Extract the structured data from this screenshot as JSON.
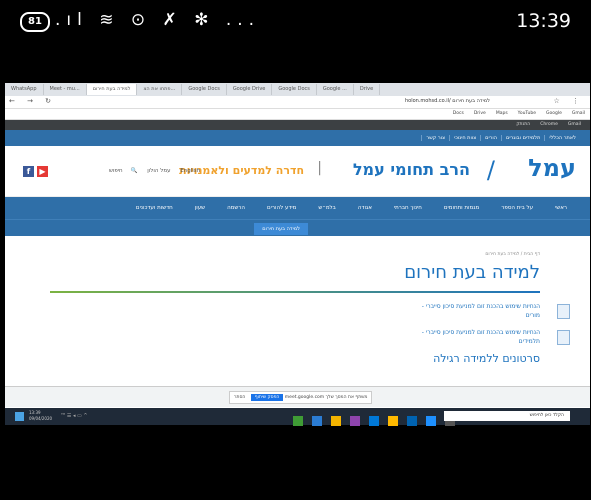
{
  "status_bar": {
    "battery": "81",
    "time": "13:39",
    "icons": ".ıl ≋ ⊙ ✗ ✻ ..."
  },
  "browser": {
    "tabs": [
      "WhatsApp",
      "Meet - mu...",
      "למידה בעת חירום",
      "פתחו את הצ...",
      "Google Docs",
      "Google Drive",
      "Google Docs",
      "Google ...",
      "Drive"
    ],
    "url": "holon.mohsd.co.il/ למידה בעת חירום",
    "bookmarks": [
      "Gmail",
      "Google",
      "YouTube",
      "Maps",
      "Drive",
      "Docs"
    ],
    "top_links": [
      "Chrome",
      "Gmail",
      "התנתק"
    ]
  },
  "utility_links": [
    "לאתר הכללי",
    "תלמידים ובוגרים",
    "הורים",
    "צוות חינוכי",
    "צור קשר"
  ],
  "logo": {
    "brand": "עמל",
    "brand_accent": "/",
    "school": "הרב תחומי עמל",
    "tagline": "חדרה למדעים ולאמנויות"
  },
  "header_tools": {
    "language": "English",
    "search": "חיפוש",
    "login": "עמל הולון"
  },
  "nav": [
    "ראשי",
    "על בית הספר",
    "מגמות ותחומים",
    "חינוך חברתי",
    "אגודה",
    "בלמ״ש",
    "מידע להורים",
    "הרשמה",
    "שעון",
    "חדשות ועדכונים"
  ],
  "subnav_active": "למידה בעת חירום",
  "content": {
    "breadcrumb": "דף הבית / למידה בעת חירום",
    "title": "למידה בעת חירום",
    "items": [
      {
        "line1": "הנחיות שימוש בהכנת זום למניעת סיכון סייברי -",
        "line2": "מורים"
      },
      {
        "line1": "הנחיות שימוש בהכנת זום למניעת סיכון סייברי -",
        "line2": "תלמידים"
      }
    ],
    "section": "סרטונים ללמידה רגילה"
  },
  "download_bar": {
    "notice": "meet.google.com משתף את המסך שלך",
    "stop": "הפסק שיתוף",
    "hide": "הסתר"
  },
  "taskbar": {
    "time": "13:39",
    "date": "09/04/2020",
    "search": "הקלד כאן לחיפוש"
  },
  "colors": {
    "brand_blue": "#1e73be",
    "brand_green": "#7cb342",
    "accent_orange": "#f0a22e",
    "nav_bg": "#2f6fa8"
  }
}
